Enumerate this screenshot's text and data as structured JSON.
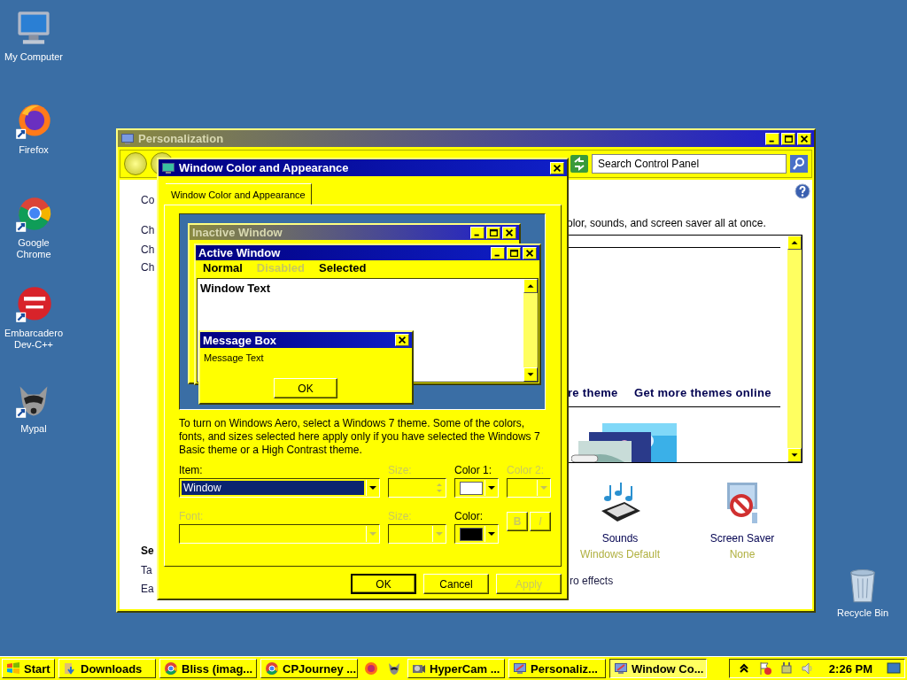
{
  "desktop_icons": [
    {
      "label": "My Computer"
    },
    {
      "label": "Firefox"
    },
    {
      "label": "Google Chrome"
    },
    {
      "label": "Embarcadero Dev-C++"
    },
    {
      "label": "Mypal"
    },
    {
      "label": "Recycle Bin"
    }
  ],
  "personalization_window": {
    "title": "Personalization",
    "search": {
      "placeholder": "Search Control Panel"
    },
    "left_links": [
      "Co",
      "Ch",
      "Ch",
      "Ch"
    ],
    "see_also": {
      "heading": "Se",
      "links": [
        "Ta",
        "Ea"
      ]
    },
    "intro": "olor, sounds, and screen saver all at once.",
    "theme_links": [
      "re theme",
      "Get more themes online"
    ],
    "settings": [
      {
        "label": "Sounds",
        "value": "Windows Default"
      },
      {
        "label": "Screen Saver",
        "value": "None"
      }
    ],
    "effects_link": "ro effects"
  },
  "dialog": {
    "title": "Window Color and Appearance",
    "tabs": [
      {
        "label": "Window Color and Appearance",
        "selected": true
      }
    ],
    "preview": {
      "inactive_title": "Inactive Window",
      "active_title": "Active Window",
      "menu": [
        {
          "label": "Normal",
          "disabled": false
        },
        {
          "label": "Disabled",
          "disabled": true
        },
        {
          "label": "Selected",
          "disabled": false
        }
      ],
      "window_text": "Window Text",
      "message_box": {
        "title": "Message Box",
        "text": "Message Text",
        "button": "OK"
      }
    },
    "description": "To turn on Windows Aero, select a Windows 7 theme.  Some of the colors, fonts, and sizes selected here apply only if you have selected the Windows 7 Basic theme or a High Contrast theme.",
    "item": {
      "label": "Item:",
      "value": "Window",
      "disabled": false
    },
    "item_size": {
      "label": "Size:",
      "disabled": true
    },
    "color_1": {
      "label": "Color 1:",
      "color": "#ffffff",
      "disabled": false
    },
    "color_2": {
      "label": "Color 2:",
      "disabled": true
    },
    "font": {
      "label": "Font:",
      "disabled": true
    },
    "font_size": {
      "label": "Size:",
      "disabled": true
    },
    "font_color": {
      "label": "Color:",
      "color": "#000000",
      "disabled": false
    },
    "style_buttons": [
      {
        "label": "B",
        "disabled": true
      },
      {
        "label": "I",
        "disabled": true
      }
    ],
    "buttons": [
      {
        "label": "OK",
        "disabled": false
      },
      {
        "label": "Cancel",
        "disabled": false
      },
      {
        "label": "Apply",
        "disabled": true
      }
    ]
  },
  "taskbar": {
    "items": [
      {
        "kind": "start",
        "label": "Start"
      },
      {
        "kind": "task",
        "label": "Downloads",
        "selected": false
      },
      {
        "kind": "task",
        "label": "Bliss (imag...",
        "selected": false
      },
      {
        "kind": "task",
        "label": "CPJourney ...",
        "selected": false
      },
      {
        "kind": "launcher"
      },
      {
        "kind": "launcher"
      },
      {
        "kind": "task",
        "label": "HyperCam ...",
        "selected": false
      },
      {
        "kind": "task",
        "label": "Personaliz...",
        "selected": false
      },
      {
        "kind": "task",
        "label": "Window Co...",
        "selected": true
      }
    ],
    "clock": "2:26 PM"
  }
}
